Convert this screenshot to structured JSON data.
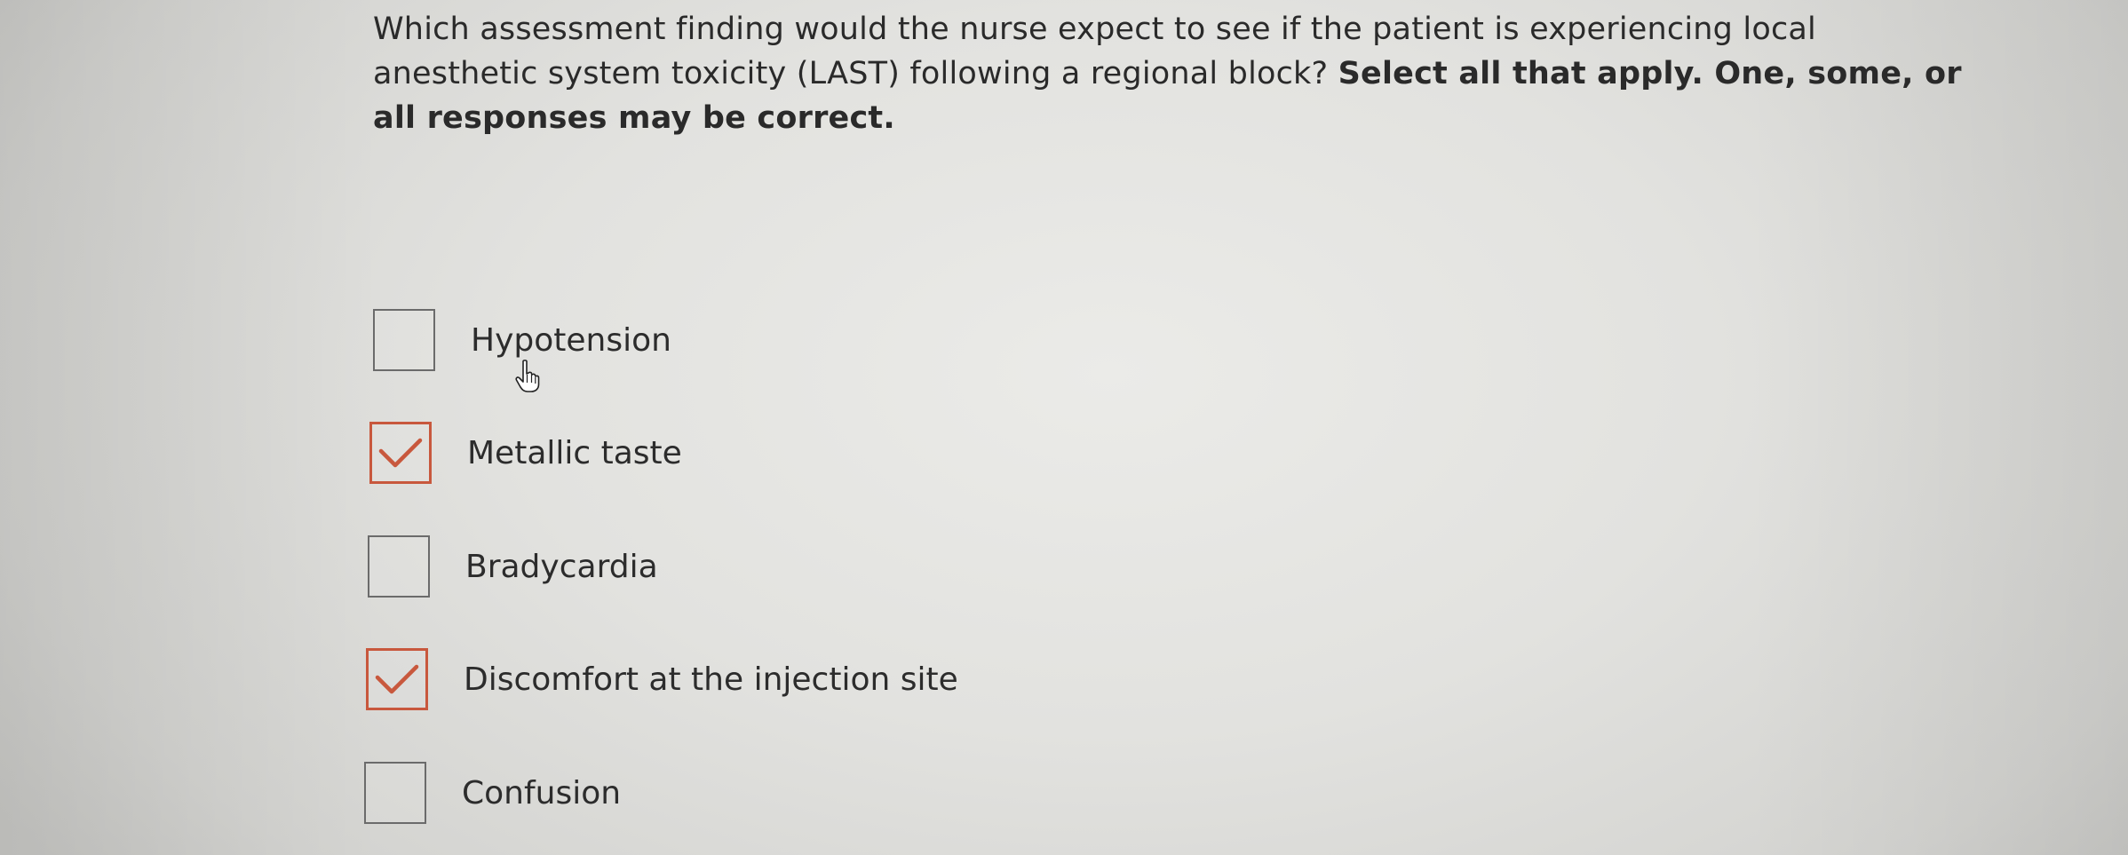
{
  "question": {
    "text": "Which assessment finding would the nurse expect to see if the patient is experiencing local anesthetic system toxicity (LAST) following a regional block?",
    "instruction": "Select all that apply. One, some, or all responses may be correct."
  },
  "options": [
    {
      "label": "Hypotension",
      "checked": false
    },
    {
      "label": "Metallic taste",
      "checked": true
    },
    {
      "label": "Bradycardia",
      "checked": false
    },
    {
      "label": "Discomfort at the injection site",
      "checked": true
    },
    {
      "label": "Confusion",
      "checked": false
    }
  ],
  "colors": {
    "check_accent": "#c8583d",
    "text": "#2c2c2c"
  },
  "cursor": {
    "icon": "hand-pointer-icon"
  }
}
